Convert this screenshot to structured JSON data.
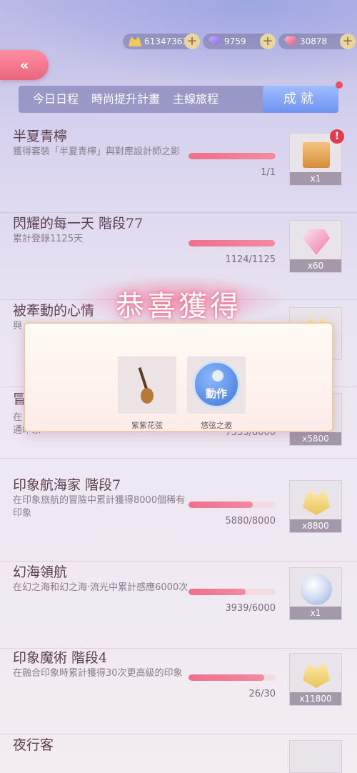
{
  "currencies": [
    {
      "name": "gold",
      "value": "61347363"
    },
    {
      "name": "gem",
      "value": "9759"
    },
    {
      "name": "pink-gem",
      "value": "30878"
    }
  ],
  "back_button": "«",
  "tabs": [
    {
      "label": "今日日程"
    },
    {
      "label": "時尚提升計畫"
    },
    {
      "label": "主線旅程"
    },
    {
      "label": "成就",
      "active": true
    }
  ],
  "achievements": [
    {
      "title": "半夏青檸",
      "desc": "獲得套裝「半夏青檸」與對應設計師之影",
      "progress": "1/1",
      "ratio": 1.0,
      "reward_count": "x1",
      "reward_icon": "gift-bag-icon",
      "alert": "!"
    },
    {
      "title": "閃耀的每一天 階段77",
      "desc": "累計登錄1125天",
      "progress": "1124/1125",
      "ratio": 0.999,
      "reward_count": "x60",
      "reward_icon": "diamond-icon"
    },
    {
      "title": "被牽動的心情",
      "desc": "與",
      "progress": "",
      "ratio": 0.0,
      "reward_count": "",
      "reward_icon": "cat-coin-icon"
    },
    {
      "title": "冒",
      "desc": "在 普通印象",
      "progress": "7333/8000",
      "ratio": 0.917,
      "reward_count": "x5800",
      "reward_icon": "cat-coin-icon"
    },
    {
      "title": "印象航海家 階段7",
      "desc": "在印象旅航的冒險中累計獲得8000個稀有印象",
      "progress": "5880/8000",
      "ratio": 0.735,
      "reward_count": "x8800",
      "reward_icon": "cat-coin-icon"
    },
    {
      "title": "幻海領航",
      "desc": "在幻之海和幻之海·流光中累計感應6000次",
      "progress": "3939/6000",
      "ratio": 0.6565,
      "reward_count": "x1",
      "reward_icon": "crystal-coin-icon"
    },
    {
      "title": "印象魔術 階段4",
      "desc": "在融合印象時累計獲得30次更高級的印象",
      "progress": "26/30",
      "ratio": 0.867,
      "reward_count": "x11800",
      "reward_icon": "cat-coin-icon"
    },
    {
      "title": "夜行客",
      "desc": "",
      "progress": "",
      "ratio": 0.0,
      "reward_count": "",
      "reward_icon": "cat-coin-icon"
    }
  ],
  "popup": {
    "title": "恭喜獲得",
    "items": [
      {
        "label": "紫紫花弦",
        "icon": "guitar-icon"
      },
      {
        "label": "悠弦之邀",
        "icon": "action-icon",
        "icon_text": "動作"
      }
    ]
  }
}
